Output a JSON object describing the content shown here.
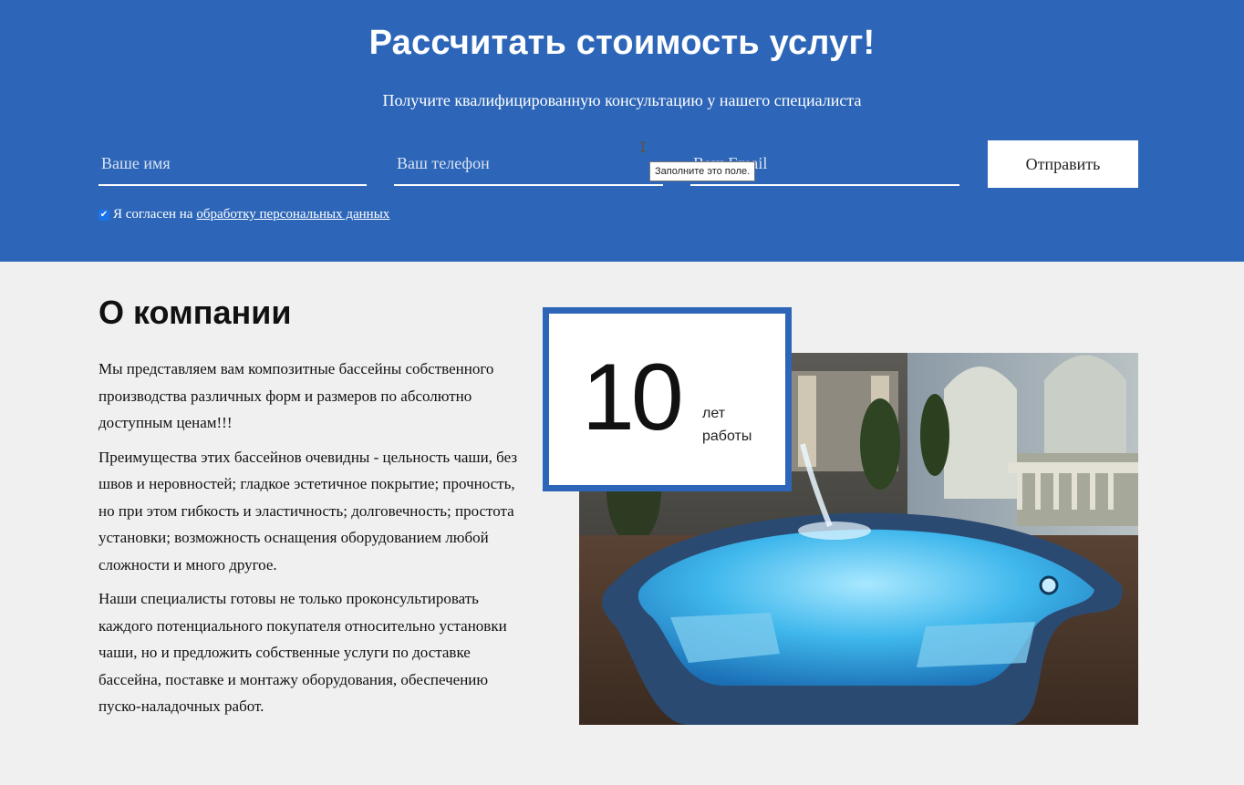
{
  "form": {
    "title": "Рассчитать стоимость услуг!",
    "subtitle": "Получите квалифицированную консультацию у нашего специалиста",
    "name_placeholder": "Ваше имя",
    "phone_placeholder": "Ваш телефон",
    "email_placeholder": "Ваш Email",
    "submit_label": "Отправить",
    "consent_text": "Я согласен на",
    "consent_link": "обработку персональных данных",
    "consent_checked": true,
    "tooltip": "Заполните это поле.",
    "accent_color": "#2d66b8"
  },
  "about": {
    "title": "О компании",
    "paragraphs": [
      "Мы представляем вам композитные бассейны собственного производства различных форм и размеров по абсолютно доступным ценам!!!",
      "Преимущества этих бассейнов очевидны - цельность чаши, без швов и неровностей; гладкое эстетичное покрытие; прочность, но при этом гибкость и эластичность; долговечность; простота установки; возможность оснащения оборудованием любой сложности и много другое.",
      "Наши специалисты готовы не только проконсультировать каждого потенциального покупателя относительно установки чаши, но и предложить собственные услуги по доставке бассейна, поставке и монтажу оборудования, обеспечению пуско-наладочных работ."
    ],
    "badge_number": "10",
    "badge_caption_line1": "лет",
    "badge_caption_line2": "работы"
  }
}
